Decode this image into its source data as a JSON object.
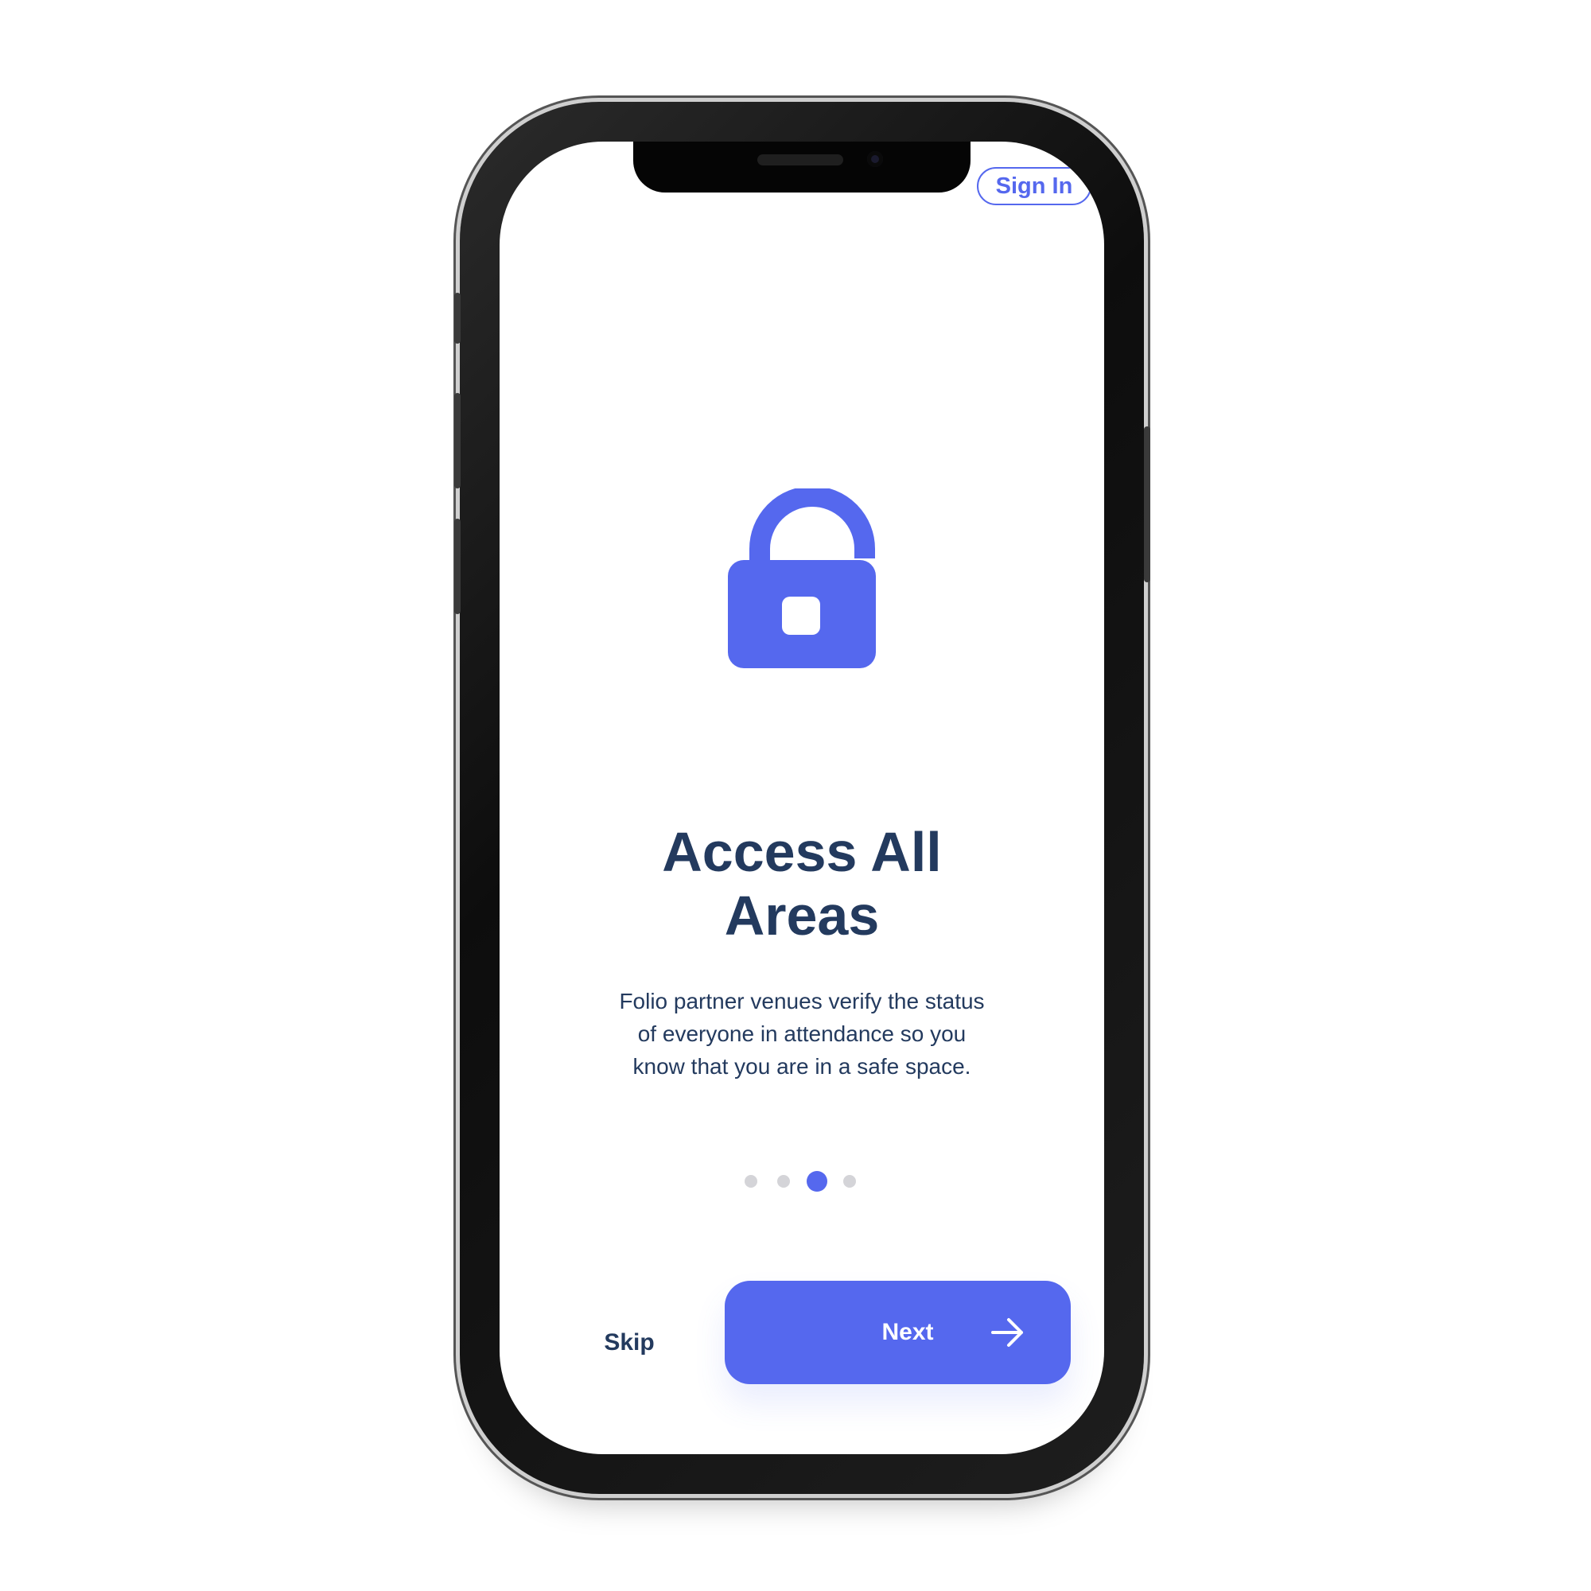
{
  "header": {
    "sign_in_label": "Sign In"
  },
  "main": {
    "icon": "unlocked-padlock-icon",
    "title": "Access All Areas",
    "description": "Folio partner venues verify the status of everyone in attendance so you know that you are in a safe space."
  },
  "pagination": {
    "total": 4,
    "active_index": 3
  },
  "footer": {
    "skip_label": "Skip",
    "next_label": "Next",
    "next_icon": "arrow-right-icon"
  },
  "colors": {
    "accent": "#5568ee",
    "text_dark": "#233a5e",
    "dot_inactive": "#d4d4d8",
    "background": "#ffffff"
  }
}
